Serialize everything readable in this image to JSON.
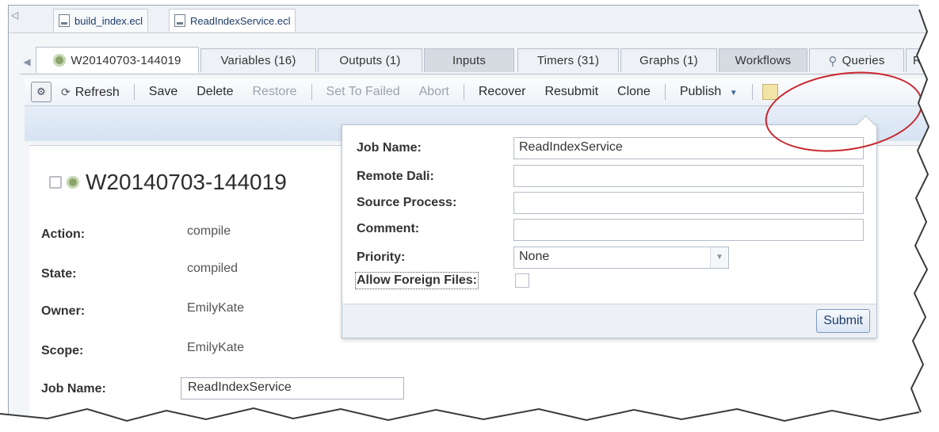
{
  "file_tabs": [
    {
      "label": "build_index.ecl",
      "active": false
    },
    {
      "label": "ReadIndexService.ecl",
      "active": true
    }
  ],
  "workunit_tabs": [
    {
      "label": "W20140703-144019",
      "active": true,
      "icon": "workunit-gear-icon"
    },
    {
      "label": "Variables (16)"
    },
    {
      "label": "Outputs (1)"
    },
    {
      "label": "Inputs"
    },
    {
      "label": "Timers (31)"
    },
    {
      "label": "Graphs (1)"
    },
    {
      "label": "Workflows"
    },
    {
      "label": "Queries",
      "icon": "search-icon"
    },
    {
      "label": "Res"
    }
  ],
  "toolbar": {
    "refresh_label": "Refresh",
    "save_label": "Save",
    "delete_label": "Delete",
    "restore_label": "Restore",
    "set_to_failed_label": "Set To Failed",
    "abort_label": "Abort",
    "recover_label": "Recover",
    "resubmit_label": "Resubmit",
    "clone_label": "Clone",
    "publish_label": "Publish"
  },
  "workunit": {
    "title": "W20140703-144019",
    "fields": {
      "action_label": "Action:",
      "action_value": "compile",
      "state_label": "State:",
      "state_value": "compiled",
      "owner_label": "Owner:",
      "owner_value": "EmilyKate",
      "scope_label": "Scope:",
      "scope_value": "EmilyKate",
      "jobname_label": "Job Name:",
      "jobname_value": "ReadIndexService"
    }
  },
  "publish_dialog": {
    "job_name_label": "Job Name:",
    "job_name_value": "ReadIndexService",
    "remote_dali_label": "Remote Dali:",
    "remote_dali_value": "",
    "source_process_label": "Source Process:",
    "source_process_value": "",
    "comment_label": "Comment:",
    "comment_value": "",
    "priority_label": "Priority:",
    "priority_value": "None",
    "allow_foreign_label": "Allow Foreign Files:",
    "allow_foreign_checked": false,
    "submit_label": "Submit"
  },
  "colors": {
    "highlight_ring": "#c9252c",
    "toolbar_band": "#d6e3f2",
    "tab_active": "#ffffff"
  }
}
